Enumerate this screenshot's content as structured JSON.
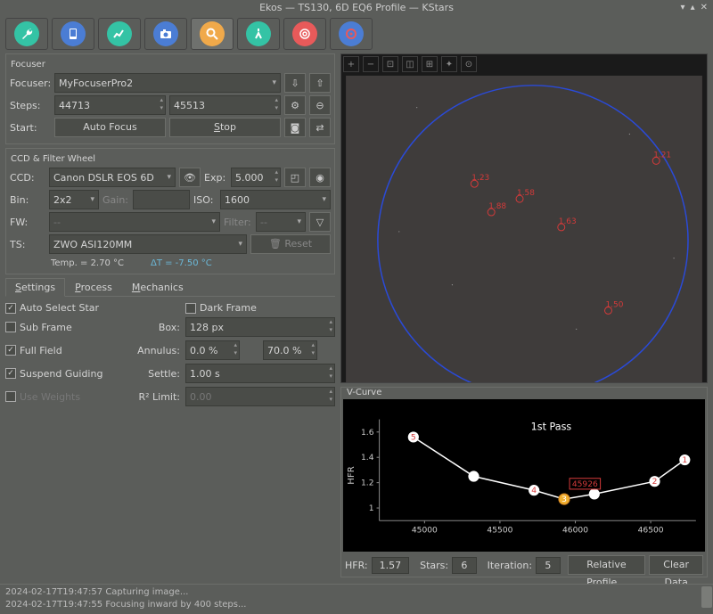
{
  "window": {
    "title": "Ekos — TS130, 6D EQ6 Profile — KStars"
  },
  "toolbar_icons": [
    "wrench",
    "tablet",
    "chart",
    "camera",
    "magnify",
    "compass",
    "target",
    "disc"
  ],
  "focuser": {
    "title": "Focuser",
    "focuser_label": "Focuser:",
    "focuser_value": "MyFocuserPro2",
    "steps_label": "Steps:",
    "steps_value": "44713",
    "goto_value": "45513",
    "start_label": "Start:",
    "autofocus_btn": "Auto Focus",
    "stop_btn": "Stop"
  },
  "ccd": {
    "title": "CCD & Filter Wheel",
    "ccd_label": "CCD:",
    "ccd_value": "Canon DSLR EOS 6D",
    "exp_label": "Exp:",
    "exp_value": "5.000",
    "bin_label": "Bin:",
    "bin_value": "2x2",
    "gain_label": "Gain:",
    "iso_label": "ISO:",
    "iso_value": "1600",
    "fw_label": "FW:",
    "fw_value": "--",
    "filter_label": "Filter:",
    "filter_value": "--",
    "ts_label": "TS:",
    "ts_value": "ZWO ASI120MM",
    "reset_btn": "Reset",
    "temp": "Temp. = 2.70 °C",
    "dt": "ΔT = -7.50 °C"
  },
  "tabs": {
    "settings": "Settings",
    "process": "Process",
    "mechanics": "Mechanics"
  },
  "settings": {
    "auto_select": "Auto Select Star",
    "dark_frame": "Dark Frame",
    "sub_frame": "Sub Frame",
    "box_label": "Box:",
    "box_value": "128 px",
    "full_field": "Full Field",
    "annulus_label": "Annulus:",
    "annulus_inner": "0.0 %",
    "annulus_outer": "70.0 %",
    "suspend_guiding": "Suspend Guiding",
    "settle_label": "Settle:",
    "settle_value": "1.00 s",
    "use_weights": "Use Weights",
    "r2_label": "R² Limit:",
    "r2_value": "0.00"
  },
  "vcurve": {
    "title": "V-Curve",
    "pass_label": "1st Pass",
    "ylabel": "HFR",
    "y_ticks": [
      "1.6",
      "1.4",
      "1.2",
      "1"
    ],
    "x_ticks": [
      "45000",
      "45500",
      "46000",
      "46500"
    ],
    "annotation": "45926"
  },
  "status": {
    "hfr_label": "HFR:",
    "hfr_value": "1.57",
    "stars_label": "Stars:",
    "stars_value": "6",
    "iter_label": "Iteration:",
    "iter_value": "5",
    "rel_profile_btn": "Relative Profile...",
    "clear_btn": "Clear Data"
  },
  "log": {
    "line1": "2024-02-17T19:47:57 Capturing image...",
    "line2": "2024-02-17T19:47:55 Focusing inward by 400 steps..."
  },
  "chart_data": {
    "type": "line",
    "title": "1st Pass",
    "xlabel": "",
    "ylabel": "HFR",
    "ylim": [
      0.9,
      1.7
    ],
    "xlim": [
      44700,
      46800
    ],
    "series": [
      {
        "name": "HFR",
        "x": [
          44926,
          45326,
          45726,
          45926,
          46126,
          46526,
          46726
        ],
        "y": [
          1.56,
          1.25,
          1.14,
          1.07,
          1.11,
          1.21,
          1.38
        ],
        "labels": [
          "5",
          "",
          "4",
          "3",
          "",
          "2",
          "1"
        ]
      }
    ],
    "solution": 45926
  }
}
